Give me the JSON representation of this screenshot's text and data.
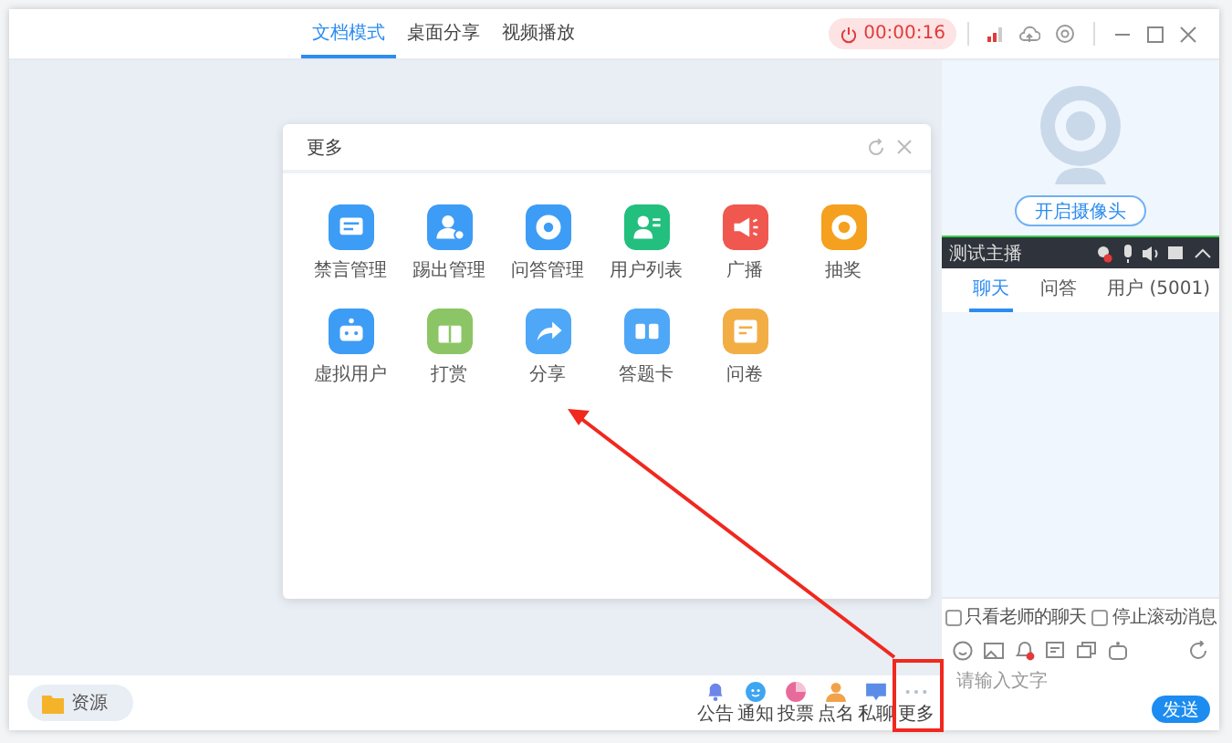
{
  "header": {
    "tabs": [
      {
        "label": "文档模式",
        "selected": true
      },
      {
        "label": "桌面分享",
        "selected": false
      },
      {
        "label": "视频播放",
        "selected": false
      }
    ],
    "timer": "00:00:16"
  },
  "dialog": {
    "title": "更多",
    "items": [
      {
        "label": "禁言管理",
        "kind": "mute",
        "color": "#3d9cf5"
      },
      {
        "label": "踢出管理",
        "kind": "kick",
        "color": "#3d9cf5"
      },
      {
        "label": "问答管理",
        "kind": "qa",
        "color": "#3d9cf5"
      },
      {
        "label": "用户列表",
        "kind": "users",
        "color": "#22bf7e"
      },
      {
        "label": "广播",
        "kind": "broadcast",
        "color": "#f0574f"
      },
      {
        "label": "抽奖",
        "kind": "lottery",
        "color": "#f5a01e"
      },
      {
        "label": "虚拟用户",
        "kind": "robot",
        "color": "#3d9cf5"
      },
      {
        "label": "打赏",
        "kind": "gift",
        "color": "#8cc565"
      },
      {
        "label": "分享",
        "kind": "share",
        "color": "#4fa7f7"
      },
      {
        "label": "答题卡",
        "kind": "card",
        "color": "#4fa7f7"
      },
      {
        "label": "问卷",
        "kind": "survey",
        "color": "#f2ae44"
      }
    ]
  },
  "toolbar": {
    "resource": "资源",
    "tools": [
      {
        "label": "公告",
        "kind": "bell",
        "color": "#6b86e8"
      },
      {
        "label": "通知",
        "kind": "notice",
        "color": "#3ea5f2"
      },
      {
        "label": "投票",
        "kind": "vote",
        "color": "#e86a9a"
      },
      {
        "label": "点名",
        "kind": "rollcall",
        "color": "#f2a24a"
      },
      {
        "label": "私聊",
        "kind": "chat",
        "color": "#5b8de8"
      },
      {
        "label": "更多",
        "kind": "more",
        "color": "#b5bcc8"
      }
    ]
  },
  "side": {
    "camera_button": "开启摄像头",
    "host": "测试主播",
    "tabs": [
      {
        "label": "聊天",
        "selected": true
      },
      {
        "label": "问答",
        "selected": false
      },
      {
        "label": "用户 (5001)",
        "selected": false
      }
    ],
    "options": [
      {
        "label": "只看老师的聊天",
        "checked": false
      },
      {
        "label": "停止滚动消息",
        "checked": false
      }
    ],
    "placeholder": "请输入文字",
    "send": "发送"
  }
}
